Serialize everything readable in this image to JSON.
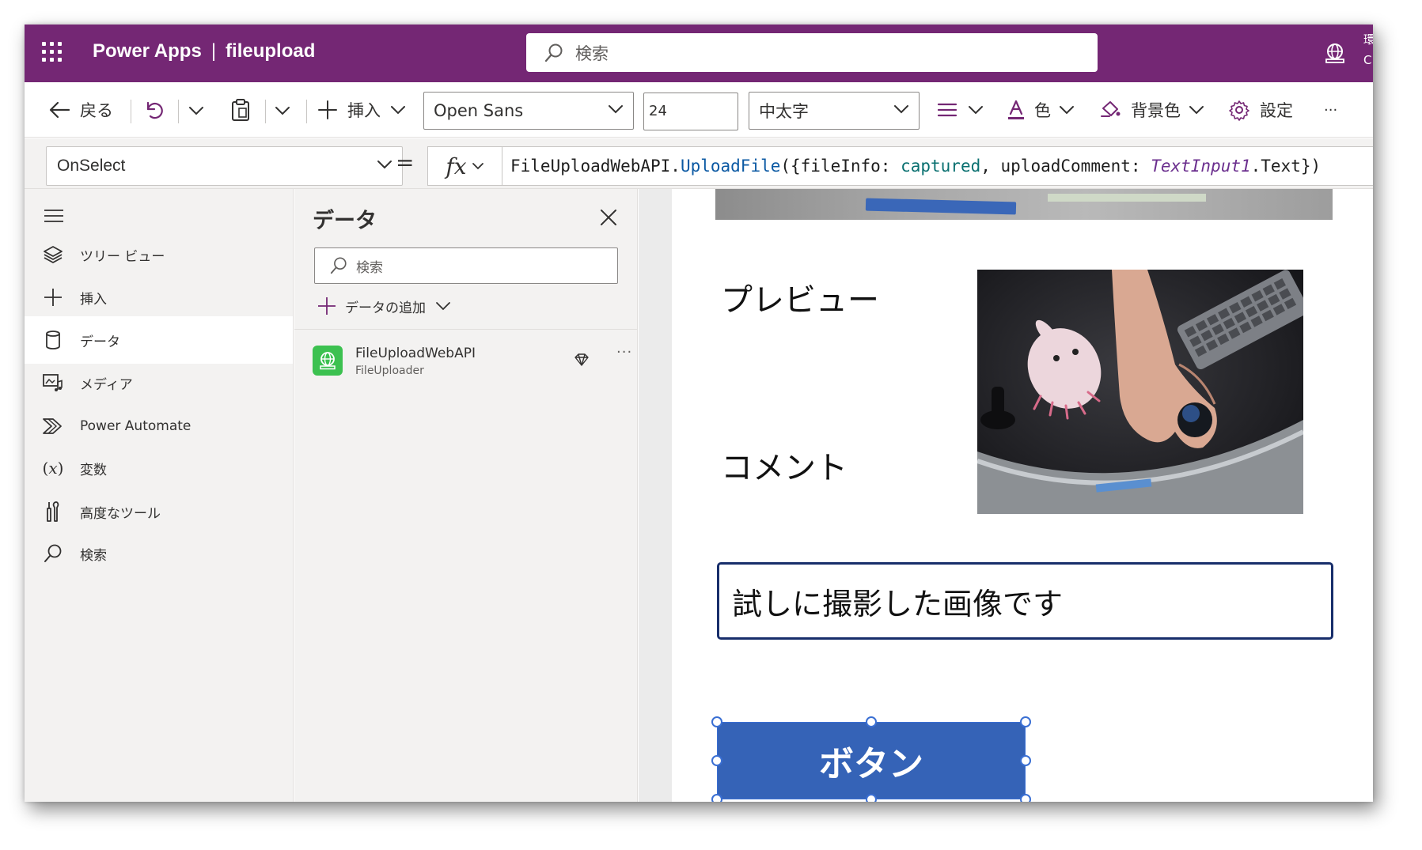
{
  "header": {
    "app_name": "Power Apps",
    "separator": "|",
    "app_title": "fileupload",
    "search_placeholder": "検索",
    "env_text_1": "環",
    "env_text_2": "C"
  },
  "toolbar": {
    "back_label": "戻る",
    "insert_label": "挿入",
    "font_family": "Open Sans",
    "font_size": "24",
    "font_weight": "中太字",
    "color_label": "色",
    "bg_color_label": "背景色",
    "settings_label": "設定",
    "more": "···"
  },
  "formula_bar": {
    "property": "OnSelect",
    "equals": "=",
    "fx": "fx",
    "tokens": {
      "t1": "FileUploadWebAPI.",
      "t2": "UploadFile",
      "t3": "({fileInfo: ",
      "t4": "captured",
      "t5": ", uploadComment: ",
      "t6": "TextInput1",
      "t7": ".Text})"
    }
  },
  "sidebar": {
    "items": [
      {
        "label": "ツリー ビュー",
        "icon": "layers-icon"
      },
      {
        "label": "挿入",
        "icon": "plus-icon"
      },
      {
        "label": "データ",
        "icon": "database-icon"
      },
      {
        "label": "メディア",
        "icon": "media-icon"
      },
      {
        "label": "Power Automate",
        "icon": "power-automate-icon"
      },
      {
        "label": "変数",
        "icon": "variable-icon"
      },
      {
        "label": "高度なツール",
        "icon": "tools-icon"
      },
      {
        "label": "検索",
        "icon": "search-icon"
      }
    ],
    "variable_glyph": "(𝑥)"
  },
  "data_pane": {
    "title": "データ",
    "search_placeholder": "検索",
    "add_data_label": "データの追加",
    "source_name": "FileUploadWebAPI",
    "source_sub": "FileUploader",
    "more": "···"
  },
  "canvas": {
    "preview_label": "プレビュー",
    "comment_label": "コメント",
    "comment_value": "試しに撮影した画像です",
    "button_label": "ボタン"
  },
  "colors": {
    "header_bg": "#742774",
    "button_bg": "#3563b7",
    "input_border": "#182e6b",
    "connector_green": "#3cc150"
  }
}
